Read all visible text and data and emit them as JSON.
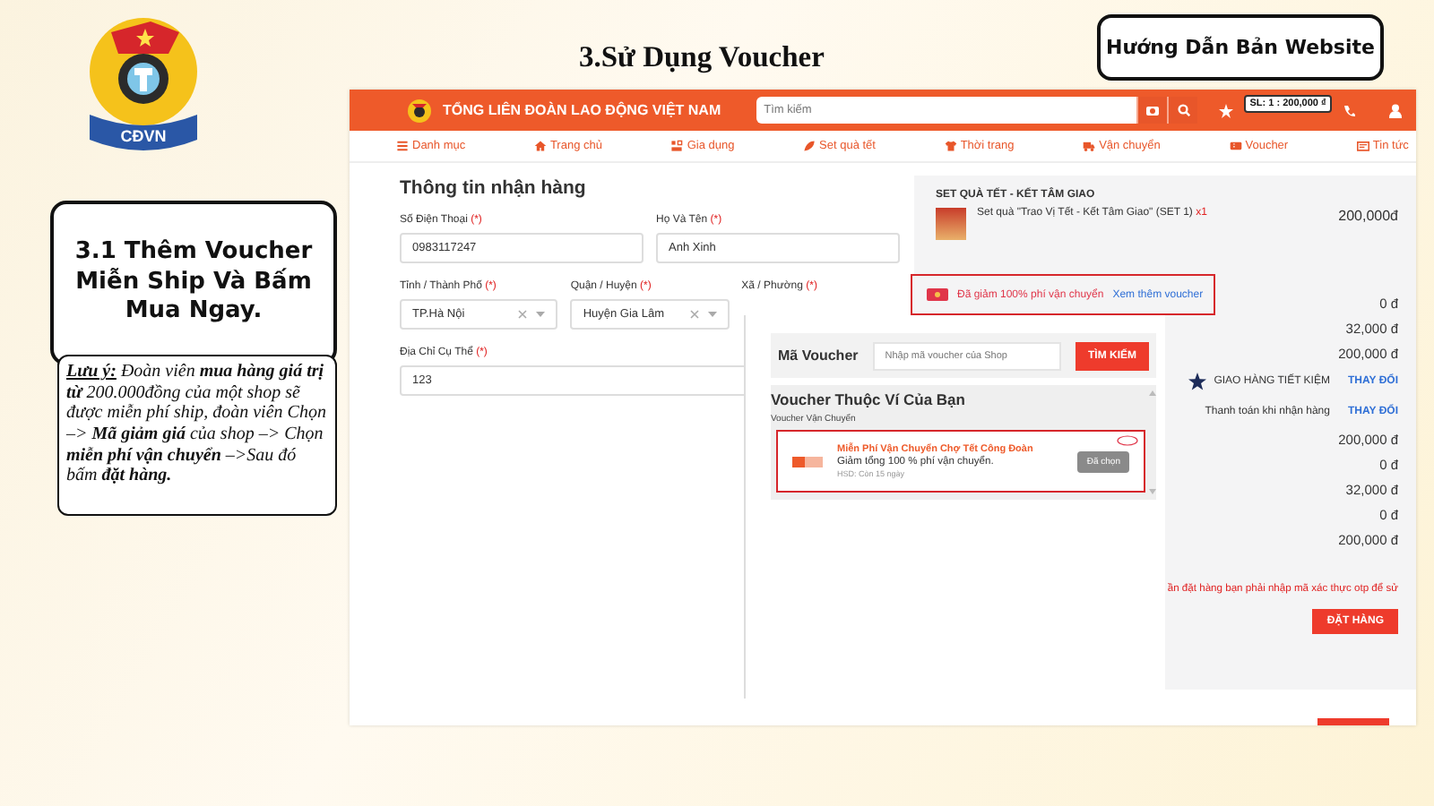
{
  "slide": {
    "title": "3.Sử Dụng Voucher",
    "guide_button": "Hướng Dẫn Bản Website",
    "logo_text": "CĐVN",
    "step_title": "3.1 Thêm Voucher Miễn Ship Và Bấm Mua Ngay.",
    "note": "**Lưu ý:** Đoàn viên **mua hàng giá trị từ** 200.000đồng của một shop sẽ được miễn phí ship, đoàn viên Chọn –> **Mã giảm giá** của shop –> Chọn **miễn phí vận chuyển** –>Sau đó bấm **đặt hàng.**"
  },
  "site": {
    "brand": "TỔNG LIÊN ĐOÀN LAO ĐỘNG VIỆT NAM",
    "search_placeholder": "Tìm kiếm",
    "cart_badge": "SL: 1 : 200,000 ₫",
    "nav": [
      {
        "label": "Danh mục"
      },
      {
        "label": "Trang chủ"
      },
      {
        "label": "Gia dụng"
      },
      {
        "label": "Set quà tết"
      },
      {
        "label": "Thời trang"
      },
      {
        "label": "Vận chuyển"
      },
      {
        "label": "Voucher"
      },
      {
        "label": "Tin tức"
      }
    ]
  },
  "form": {
    "heading": "Thông tin nhận hàng",
    "fields": [
      {
        "kind": "text",
        "label": "Số Điện Thoại",
        "required": "(*)",
        "value": "0983117247"
      },
      {
        "kind": "text",
        "label": "Họ Và Tên",
        "required": "(*)",
        "value": "Anh Xinh"
      },
      {
        "kind": "select",
        "label": "Tỉnh / Thành Phố",
        "required": "(*)",
        "value": "TP.Hà Nội"
      },
      {
        "kind": "select",
        "label": "Quận / Huyện",
        "required": "(*)",
        "value": "Huyện Gia Lâm"
      },
      {
        "kind": "label",
        "label": "Xã / Phường",
        "required": "(*)"
      },
      {
        "kind": "text",
        "label": "Địa Chỉ Cụ Thể",
        "required": "(*)",
        "value": "123"
      }
    ]
  },
  "summary": {
    "shop": "SET QUÀ TẾT - KẾT TÂM GIAO",
    "product": {
      "name": "Set quà \"Trao Vị Tết - Kết Tâm Giao\" (SET 1)",
      "qty": "x1",
      "price": "200,000đ"
    },
    "voucher_applied": {
      "text": "Đã giảm 100% phí vận chuyển",
      "link": "Xem thêm voucher"
    },
    "rows": [
      {
        "kind": "amount",
        "value": "0 đ"
      },
      {
        "kind": "amount",
        "value": "32,000 đ"
      },
      {
        "kind": "amount",
        "value": "200,000 đ"
      },
      {
        "kind": "shipping",
        "label": "GIAO HÀNG TIẾT KIỆM",
        "action": "THAY ĐỔI"
      },
      {
        "kind": "payment",
        "label": "Thanh toán khi nhận hàng",
        "action": "THAY ĐỔI"
      },
      {
        "kind": "amount",
        "value": "200,000 đ"
      },
      {
        "kind": "amount",
        "value": "0 đ"
      },
      {
        "kind": "amount",
        "value": "32,000 đ"
      },
      {
        "kind": "amount",
        "value": "0 đ"
      },
      {
        "kind": "amount",
        "value": "200,000 đ"
      }
    ],
    "otp_note": "ần đặt hàng bạn phải nhập mã xác thực otp để sử",
    "order_button": "ĐẶT HÀNG"
  },
  "voucher_popup": {
    "label": "Mã Voucher",
    "placeholder": "Nhập mã voucher của Shop",
    "search_button": "TÌM KIẾM",
    "heading": "Voucher Thuộc Ví Của Bạn",
    "group": "Voucher Vận Chuyển",
    "vouchers": [
      {
        "title": "Miễn Phí Vận Chuyển Chợ Tết Công Đoàn",
        "desc": "Giảm tổng 100 % phí vận chuyển.",
        "expiry": "HSD: Còn 15 ngày",
        "button": "Đã chọn",
        "selected": true
      }
    ]
  }
}
